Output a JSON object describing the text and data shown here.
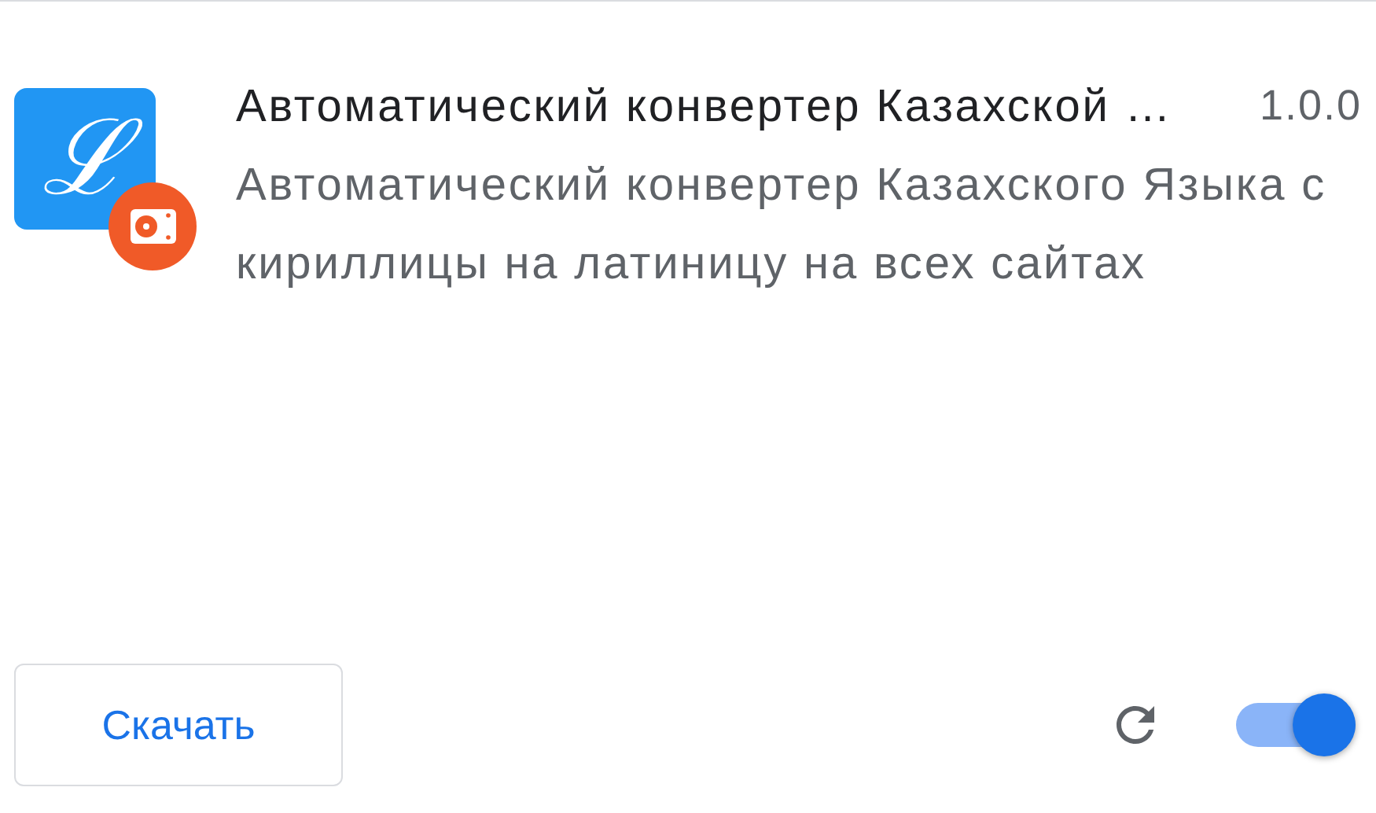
{
  "extension": {
    "logo_text": "ℒ",
    "name": "Автоматический конвертер Казахской …",
    "version": "1.0.0",
    "description": "Автоматический конвертер Казахского Языка с кириллицы на латиницу на всех сайтах"
  },
  "download_button": {
    "label": "Скачать"
  },
  "toggle": {
    "on": true
  }
}
